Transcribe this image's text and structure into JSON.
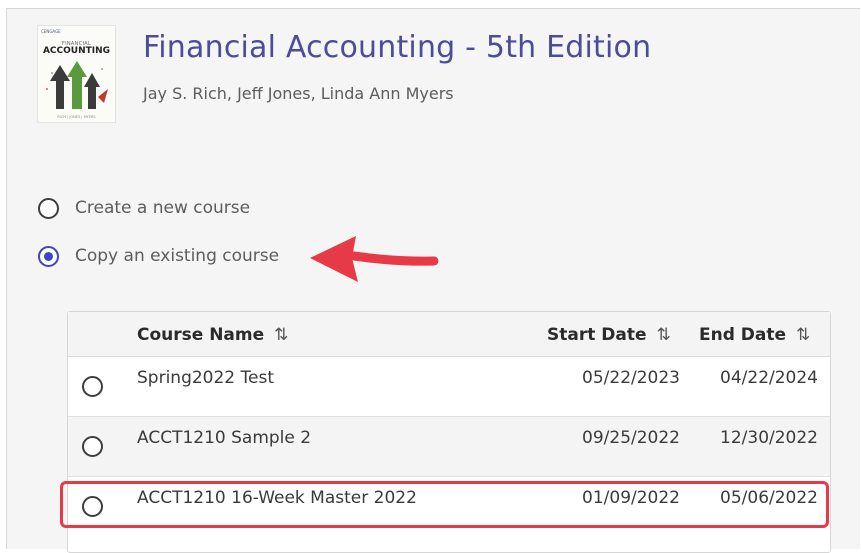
{
  "book": {
    "title": "Financial Accounting - 5th Edition",
    "authors": "Jay S. Rich, Jeff Jones, Linda Ann Myers",
    "cover": {
      "publisher": "CENGAGE",
      "title_line1": "FINANCIAL",
      "title_line2": "ACCOUNTING",
      "authors": "RICH | JONES | MYERS"
    }
  },
  "options": [
    {
      "label": "Create a new course",
      "selected": false
    },
    {
      "label": "Copy an existing course",
      "selected": true
    }
  ],
  "table": {
    "headers": {
      "course_name": "Course Name",
      "start_date": "Start Date",
      "end_date": "End Date",
      "sort_icon": "⇅"
    },
    "rows": [
      {
        "name": "Spring2022 Test",
        "start": "05/22/2023",
        "end": "04/22/2024"
      },
      {
        "name": "ACCT1210 Sample 2",
        "start": "09/25/2022",
        "end": "12/30/2022"
      },
      {
        "name": "ACCT1210 16-Week Master 2022",
        "start": "01/09/2022",
        "end": "05/06/2022"
      }
    ]
  },
  "colors": {
    "title": "#4b4d99",
    "radio_selected": "#3c48b8",
    "annotation": "#e63a46"
  },
  "icons": [
    "sort-icon",
    "annotation-arrow-icon",
    "book-cover-image"
  ]
}
